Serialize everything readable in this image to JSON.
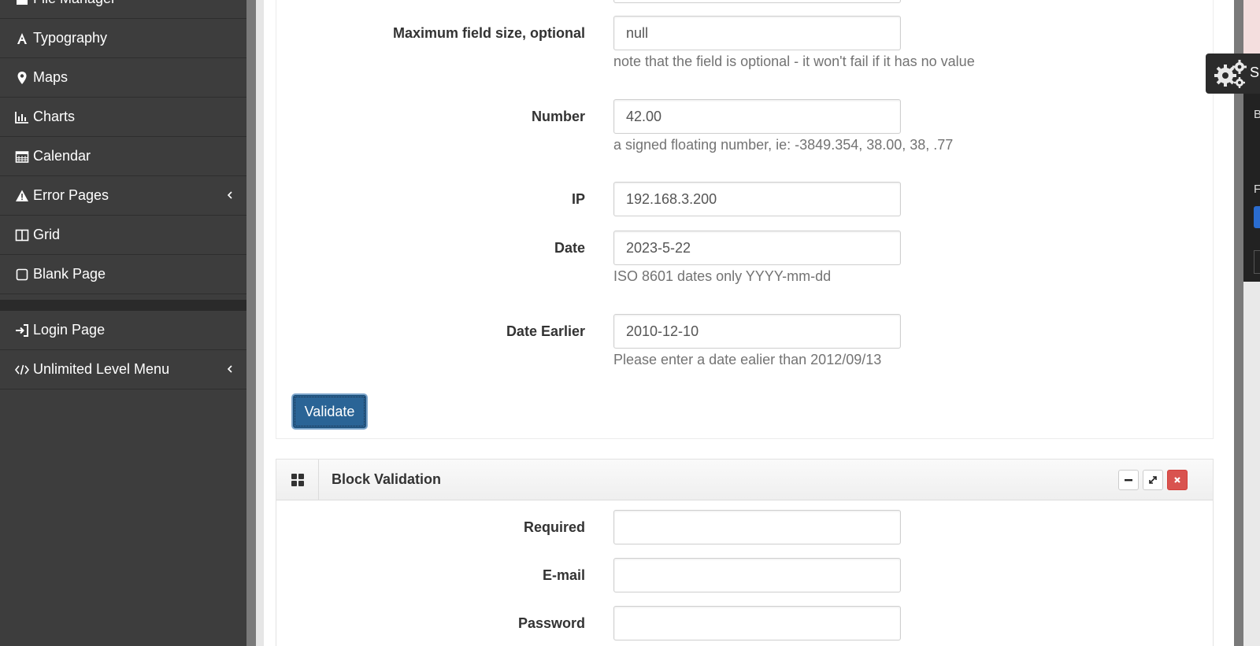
{
  "sidebar": {
    "items": [
      {
        "label": "File Manager",
        "icon": "file-icon"
      },
      {
        "label": "Typography",
        "icon": "font-icon"
      },
      {
        "label": "Maps",
        "icon": "map-marker-icon"
      },
      {
        "label": "Charts",
        "icon": "bar-chart-icon"
      },
      {
        "label": "Calendar",
        "icon": "calendar-icon"
      },
      {
        "label": "Error Pages",
        "icon": "warning-icon"
      },
      {
        "label": "Grid",
        "icon": "columns-icon"
      },
      {
        "label": "Blank Page",
        "icon": "square-icon"
      },
      {
        "label": "Login Page",
        "icon": "sign-in-icon"
      },
      {
        "label": "Unlimited Level Menu",
        "icon": "code-icon"
      }
    ]
  },
  "form1": {
    "max_size": {
      "label": "Maximum field size, optional",
      "value": "null",
      "help": "note that the field is optional - it won't fail if it has no value"
    },
    "number": {
      "label": "Number",
      "value": "42.00",
      "help": "a signed floating number, ie: -3849.354, 38.00, 38, .77"
    },
    "ip": {
      "label": "IP",
      "value": "192.168.3.200"
    },
    "date": {
      "label": "Date",
      "value": "2023-5-22",
      "help": "ISO 8601 dates only YYYY-mm-dd"
    },
    "date_earlier": {
      "label": "Date Earlier",
      "value": "2010-12-10",
      "help": "Please enter a date ealier than 2012/09/13"
    },
    "validate_label": "Validate"
  },
  "block_validation": {
    "title": "Block Validation",
    "fields": [
      {
        "label": "Required",
        "value": ""
      },
      {
        "label": "E-mail",
        "value": ""
      },
      {
        "label": "Password",
        "value": ""
      }
    ]
  },
  "right_panel": {
    "tab_letter": "S",
    "letters": [
      "B",
      "F"
    ]
  },
  "colors": {
    "sidebar_bg": "#3d3d3d",
    "primary_button": "#2a6496",
    "danger": "#d9534f"
  }
}
